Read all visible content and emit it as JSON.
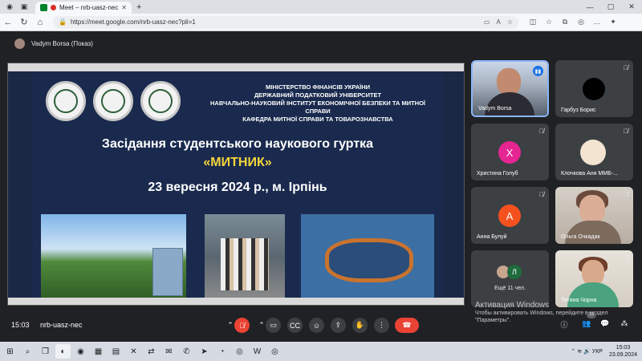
{
  "browser": {
    "tab_title": "Meet – nrb-uasz-nec",
    "url": "https://meet.google.com/nrb-uasz-nec?pli=1"
  },
  "presenter": {
    "label": "Vadym Borsa (Показ)"
  },
  "slide": {
    "header_lines": [
      "МІНІСТЕРСТВО ФІНАНСІВ УКРАЇНИ",
      "ДЕРЖАВНИЙ ПОДАТКОВИЙ УНІВЕРСИТЕТ",
      "НАВЧАЛЬНО-НАУКОВИЙ ІНСТИТУТ ЕКОНОМІЧНОЇ БЕЗПЕКИ ТА МИТНОЇ СПРАВИ",
      "КАФЕДРА МИТНОЇ СПРАВИ ТА ТОВАРОЗНАВСТВА"
    ],
    "title": "Засідання студентського наукового гуртка",
    "name": "«МИТНИК»",
    "date_place": "23 вересня 2024 р., м. Ірпінь"
  },
  "participants": [
    {
      "name": "Vadym Borsa"
    },
    {
      "name": "Гарбуз Борис"
    },
    {
      "name": "Христина Голуб",
      "initial": "Х",
      "color": "#e52592"
    },
    {
      "name": "Клочкова Аня ММБ-..."
    },
    {
      "name": "Анна Булуй",
      "initial": "А",
      "color": "#f4511e"
    },
    {
      "name": "Ольга Очкадак"
    },
    {
      "more_initial": "Л",
      "more_text": "Ещё 11 чел."
    },
    {
      "name": "Тетяна Чорна"
    }
  ],
  "activation": {
    "title": "Активация Windows",
    "line1": "Чтобы активировать Windows, перейдите в раздел",
    "line2": "\"Параметры\"."
  },
  "meeting": {
    "time": "15:03",
    "code": "nrb-uasz-nec",
    "people_count": "19"
  },
  "taskbar": {
    "lang": "УКР",
    "time": "15:03",
    "date": "23.09.2024"
  }
}
